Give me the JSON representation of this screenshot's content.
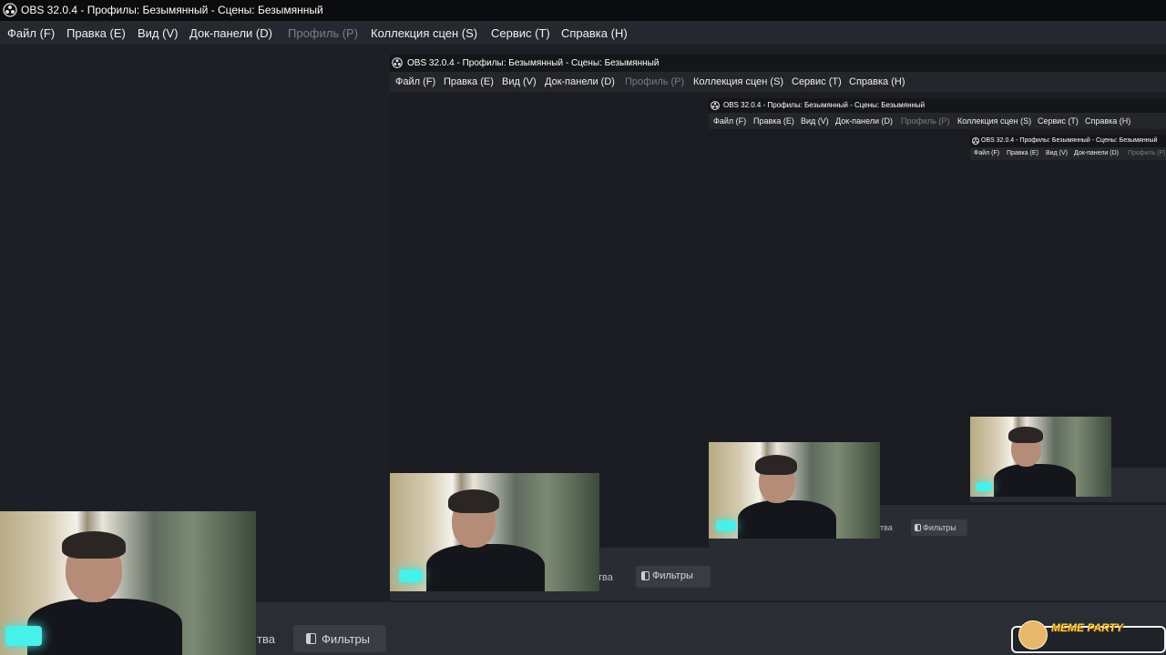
{
  "window": {
    "title": "OBS 32.0.4 - Профилы: Безымянный - Сцены: Безымянный"
  },
  "menu": [
    {
      "label": "Файл (F)",
      "disabled": false
    },
    {
      "label": "Правка (E)",
      "disabled": false
    },
    {
      "label": "Вид (V)",
      "disabled": false
    },
    {
      "label": "Док-панели (D)",
      "disabled": false
    },
    {
      "label": "Профиль (P)",
      "disabled": true
    },
    {
      "label": "Коллекция сцен (S)",
      "disabled": false
    },
    {
      "label": "Сервис (T)",
      "disabled": false
    },
    {
      "label": "Справка (H)",
      "disabled": false
    }
  ],
  "bottom": {
    "properties_partial": "тва",
    "filters_label": "Фильтры"
  },
  "nested": {
    "title": "OBS 32.0.4 - Профилы: Безымянный - Сцены: Безымянный",
    "properties_partial": "тва",
    "filters_label": "Фильтры"
  },
  "overlay": {
    "meme_text": "MEME PARTY"
  },
  "colors": {
    "background": "#1d1f26",
    "menubar": "#26282f",
    "titlebar": "#0b0c0e",
    "disabled_text": "#7d7f86"
  }
}
